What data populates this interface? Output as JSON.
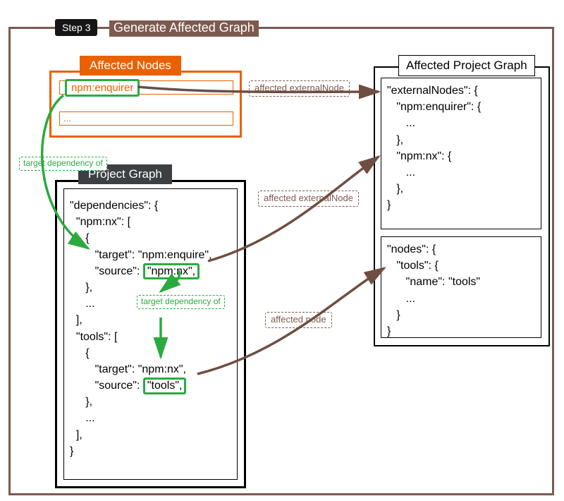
{
  "header": {
    "step_label": "Step 3",
    "title": "Generate Affected Graph"
  },
  "affected_nodes": {
    "header": "Affected Nodes",
    "items": [
      "npm:enquirer",
      "..."
    ]
  },
  "project_graph": {
    "header": "Project Graph",
    "code_part1": "\"dependencies\": {\n  \"npm:nx\": [\n     {\n        \"target\": \"npm:enquire\",\n        \"source\": ",
    "hl_npmnx": "\"npm:nx\",",
    "code_part2": "\n     },\n     ...\n  ],\n  \"tools\": [\n     {\n        \"target\": \"npm:nx\",\n        \"source\": ",
    "hl_tools": "\"tools\",",
    "code_part3": "\n     },\n     ...\n  ],\n}"
  },
  "affected_project_graph": {
    "header": "Affected Project Graph",
    "external_nodes": "\"externalNodes\": {\n   \"npm:enquirer\": {\n      ...\n   },\n   \"npm:nx\": {\n      ...\n   },\n}",
    "nodes": "\"nodes\": {\n   \"tools\": {\n      \"name\": \"tools\"\n      ...\n   }\n}"
  },
  "labels": {
    "affected_externalNode": "affected\nexternalNode",
    "affected_node": "affected node",
    "target_dependency_of": "target\ndependency of"
  }
}
